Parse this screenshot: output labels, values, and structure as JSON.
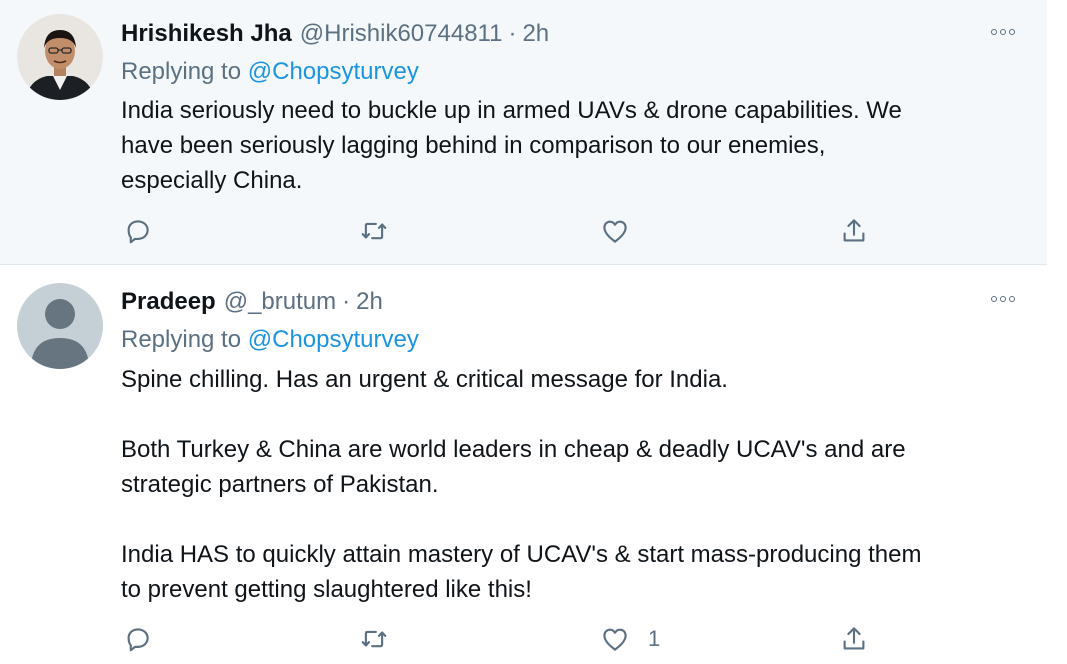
{
  "tweets": [
    {
      "author": {
        "name": "Hrishikesh Jha",
        "handle": "@Hrishik60744811",
        "avatar": "profile-photo"
      },
      "separator": "·",
      "time": "2h",
      "replying_prefix": "Replying to",
      "replying_to": "@Chopsyturvey",
      "paragraphs": [
        "India seriously need to buckle up in armed UAVs & drone capabilities.  We\nhave been seriously lagging behind in comparison to our enemies,\nespecially China."
      ],
      "actions": {
        "reply_icon": "reply-icon",
        "retweet_icon": "retweet-icon",
        "like_icon": "heart-icon",
        "like_count": "",
        "share_icon": "share-icon"
      }
    },
    {
      "author": {
        "name": "Pradeep",
        "handle": "@_brutum",
        "avatar": "default-avatar"
      },
      "separator": "·",
      "time": "2h",
      "replying_prefix": "Replying to",
      "replying_to": "@Chopsyturvey",
      "paragraphs": [
        "Spine chilling. Has an urgent & critical message for India.",
        "Both Turkey & China are world leaders in cheap & deadly UCAV's and are\nstrategic partners of Pakistan.",
        "India HAS to quickly attain mastery of UCAV's & start mass-producing them\nto prevent getting slaughtered like this!"
      ],
      "actions": {
        "reply_icon": "reply-icon",
        "retweet_icon": "retweet-icon",
        "like_icon": "heart-icon",
        "like_count": "1",
        "share_icon": "share-icon"
      }
    }
  ],
  "colors": {
    "text": "#0f1419",
    "secondary": "#5b7083",
    "link": "#1b95e0",
    "highlight_bg": "#f5f8fa"
  }
}
